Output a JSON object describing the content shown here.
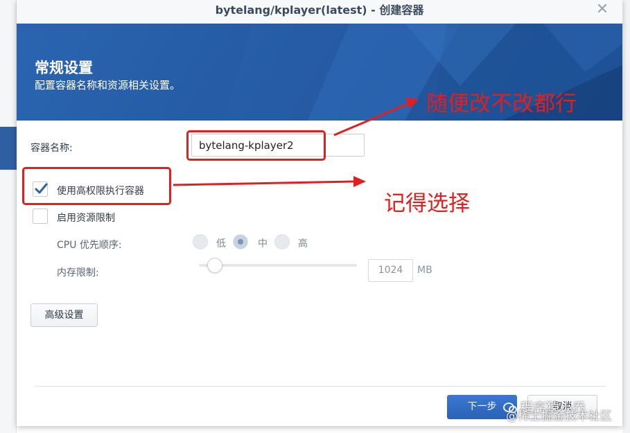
{
  "dialog": {
    "title": "bytelang/kplayer(latest) - 创建容器",
    "close_icon": "close-icon"
  },
  "banner": {
    "title": "常规设置",
    "subtitle": "配置容器名称和资源相关设置。"
  },
  "form": {
    "container_name_label": "容器名称:",
    "container_name_value": "bytelang-kplayer2",
    "high_privilege_label": "使用高权限执行容器",
    "high_privilege_checked": true,
    "resource_limit_label": "启用资源限制",
    "resource_limit_checked": false,
    "cpu_priority_label": "CPU 优先顺序:",
    "cpu_options": [
      "低",
      "中",
      "高"
    ],
    "cpu_selected": "中",
    "memory_limit_label": "内存限制:",
    "memory_value": "1024",
    "memory_unit": "MB",
    "memory_slider_fraction": 0.1
  },
  "buttons": {
    "advanced": "高级设置",
    "next": "下一步",
    "cancel": "取消"
  },
  "annotations": {
    "name_note": "随便改不改都行",
    "privilege_note": "记得选择",
    "color": "#e11f1f"
  },
  "watermark": {
    "line1": "程序猿小乔",
    "line2": "@稀土掘金技术社区"
  }
}
